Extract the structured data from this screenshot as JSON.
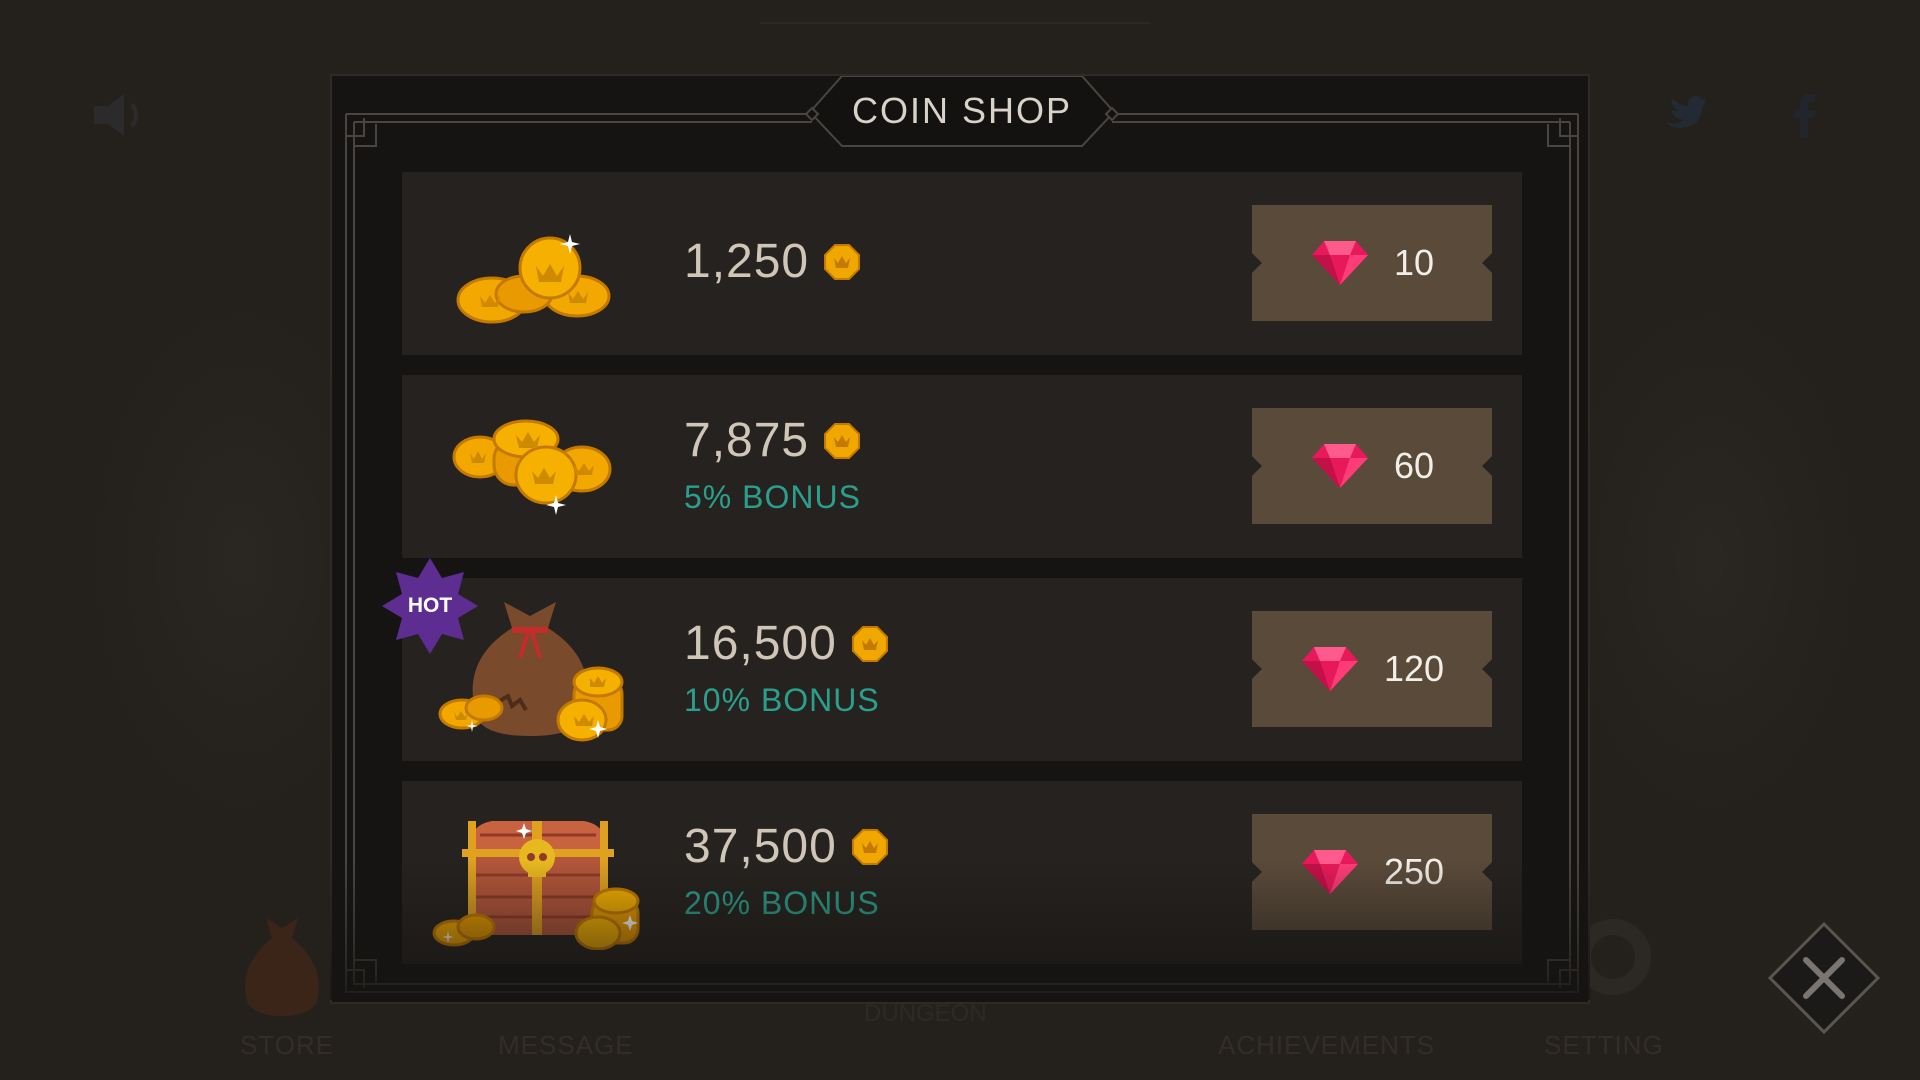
{
  "shop": {
    "title": "COIN SHOP",
    "items": [
      {
        "amount": "1,250",
        "bonus": "",
        "price": "10",
        "icon": "coin-pile-small-icon",
        "badge": ""
      },
      {
        "amount": "7,875",
        "bonus": "5% BONUS",
        "price": "60",
        "icon": "coin-pile-large-icon",
        "badge": ""
      },
      {
        "amount": "16,500",
        "bonus": "10% BONUS",
        "price": "120",
        "icon": "coin-sack-icon",
        "badge": "HOT"
      },
      {
        "amount": "37,500",
        "bonus": "20% BONUS",
        "price": "250",
        "icon": "treasure-chest-icon",
        "badge": ""
      }
    ]
  },
  "background": {
    "nav": {
      "store": "STORE",
      "message": "MESSAGE",
      "dungeon": "DUNGEON",
      "achievements": "ACHIEVEMENTS",
      "setting": "SETTING"
    }
  },
  "colors": {
    "bonus": "#2aa08c",
    "price_button": "#5a4a3a",
    "gem": "#e8195a",
    "coin": "#f0a800",
    "hot_badge": "#5e2d91"
  }
}
